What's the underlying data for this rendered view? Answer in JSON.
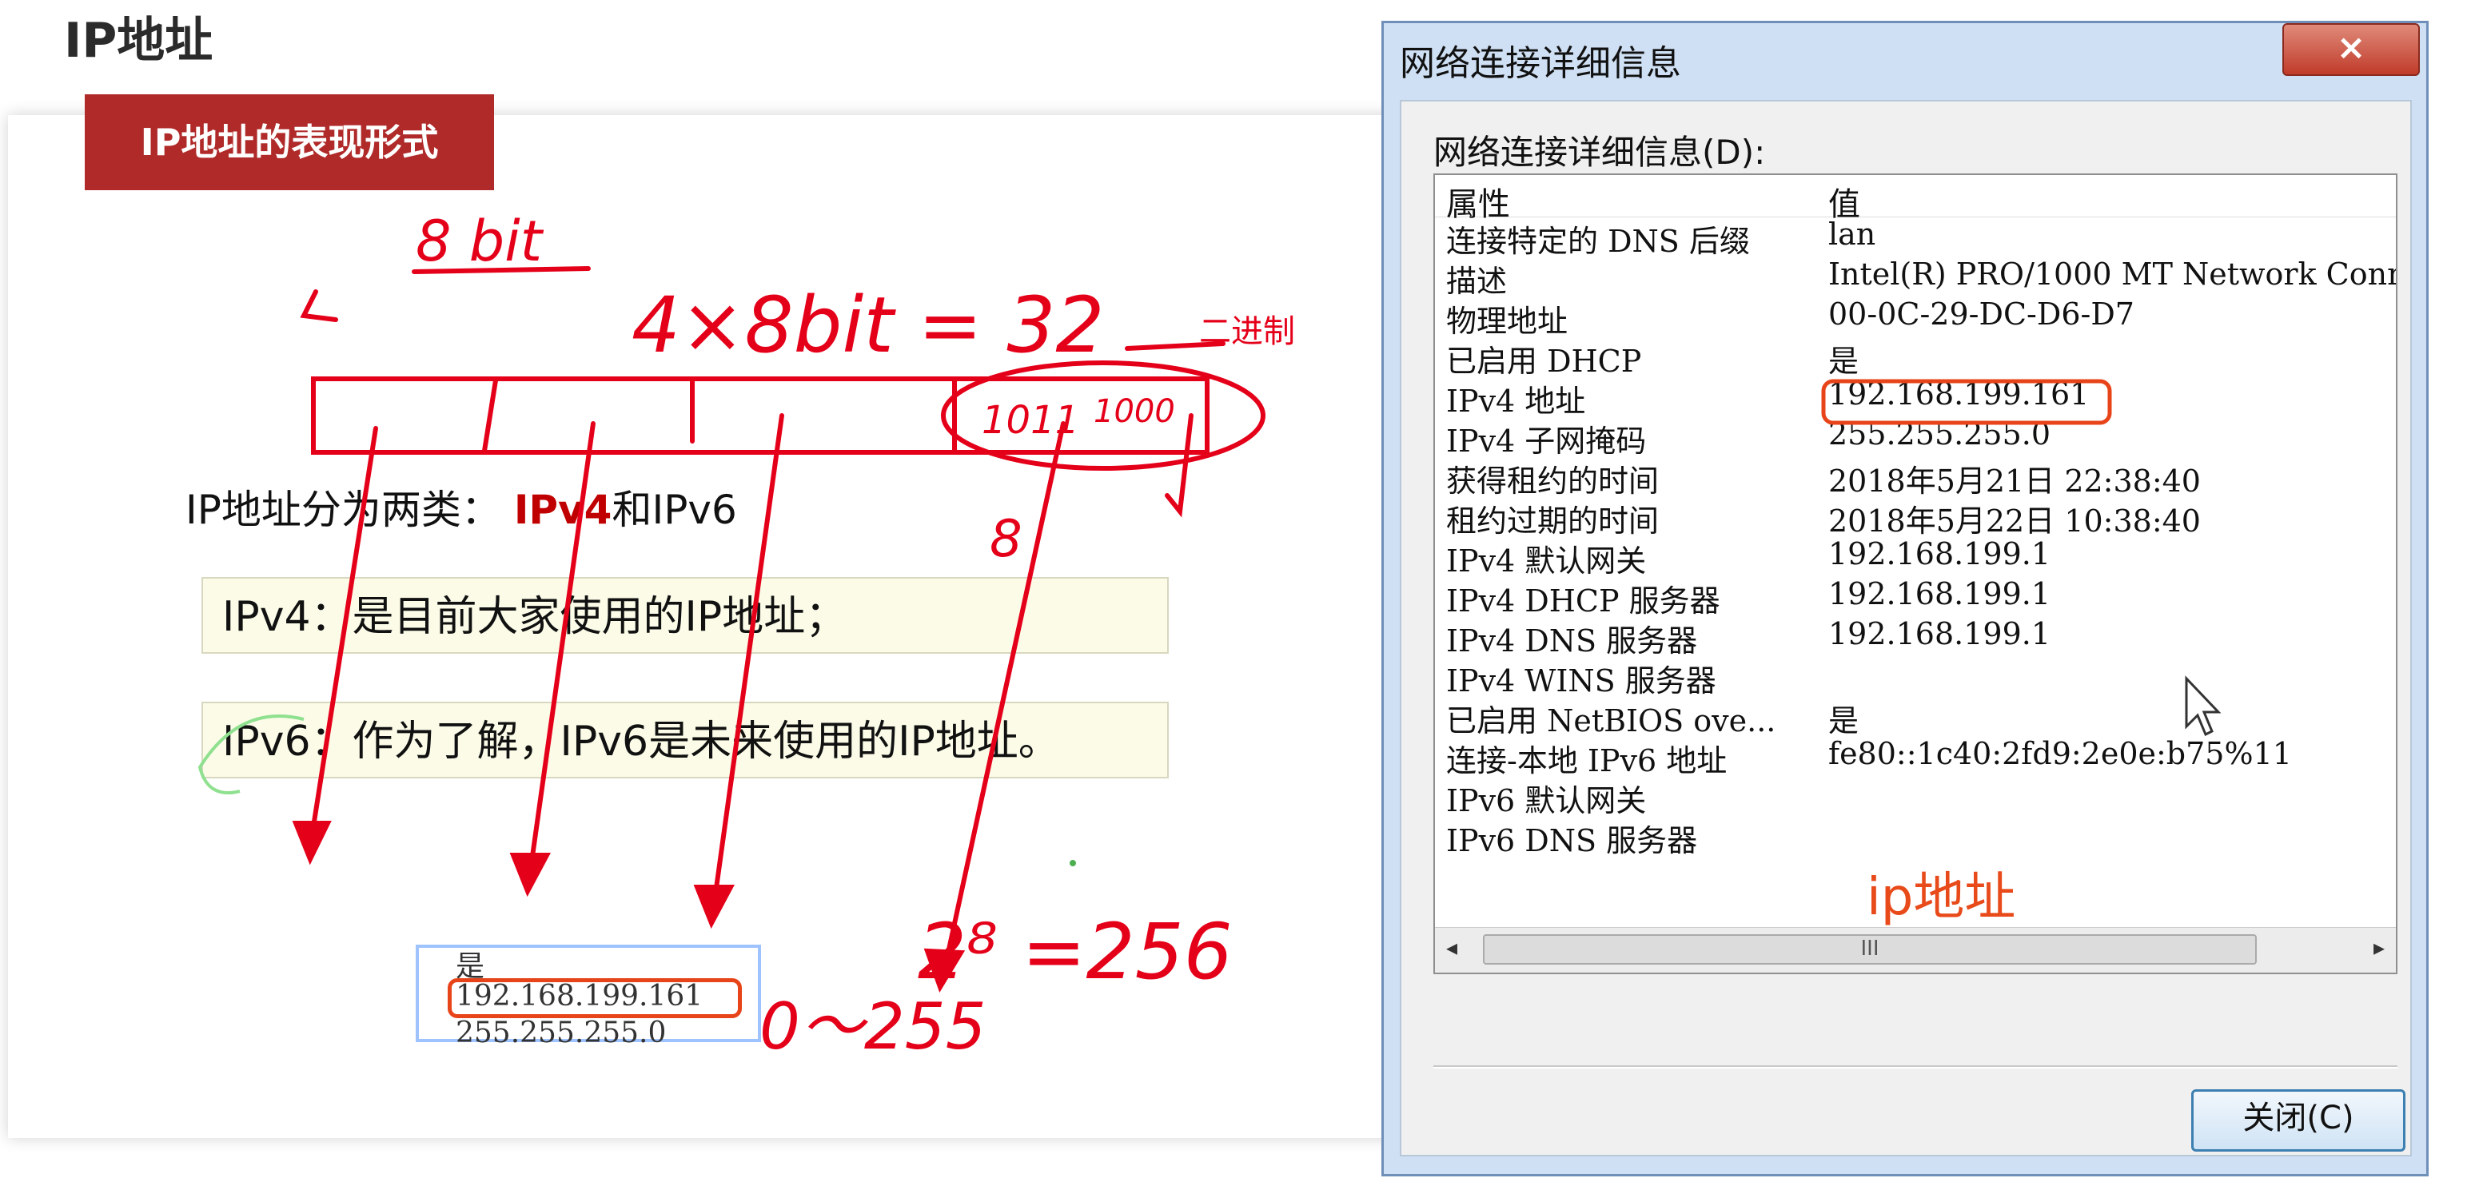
{
  "page_title": "IP地址",
  "section_tab": "IP地址的表现形式",
  "intro": {
    "prefix": "IP地址分为两类：",
    "ipv4": "IPv4",
    "middle": "和",
    "ipv6": "IPv6"
  },
  "boxes": {
    "ipv4_text": "IPv4：是目前大家使用的IP地址；",
    "ipv6_text": "IPv6：作为了解，IPv6是未来使用的IP地址。"
  },
  "snippet": {
    "row1": "是",
    "row2": "192.168.199.161",
    "row3": "255.255.255.0"
  },
  "annotations": {
    "8bit": "8 bit",
    "formula": "4×8bit = 32",
    "binary": "二进制",
    "bits_example_1": "1011",
    "bits_example_2": "1000",
    "range": "0～255",
    "pow": "2⁸ =256",
    "eight": "8"
  },
  "colors": {
    "accent_red": "#b02a2a",
    "annotation_red": "#e5001a",
    "highlight_orange": "#e8441a",
    "title_blue": "#cfe0f4"
  },
  "dialog": {
    "title": "网络连接详细信息",
    "close_icon": "×",
    "group_label": "网络连接详细信息(D):",
    "columns": {
      "property": "属性",
      "value": "值"
    },
    "rows": [
      {
        "p": "连接特定的 DNS 后缀",
        "v": "lan"
      },
      {
        "p": "描述",
        "v": "Intel(R) PRO/1000 MT Network Conne"
      },
      {
        "p": "物理地址",
        "v": "00-0C-29-DC-D6-D7"
      },
      {
        "p": "已启用 DHCP",
        "v": "是"
      },
      {
        "p": "IPv4 地址",
        "v": "192.168.199.161"
      },
      {
        "p": "IPv4 子网掩码",
        "v": "255.255.255.0"
      },
      {
        "p": "获得租约的时间",
        "v": "2018年5月21日 22:38:40"
      },
      {
        "p": "租约过期的时间",
        "v": "2018年5月22日 10:38:40"
      },
      {
        "p": "IPv4 默认网关",
        "v": "192.168.199.1"
      },
      {
        "p": "IPv4 DHCP 服务器",
        "v": "192.168.199.1"
      },
      {
        "p": "IPv4 DNS 服务器",
        "v": "192.168.199.1"
      },
      {
        "p": "IPv4 WINS 服务器",
        "v": ""
      },
      {
        "p": "已启用 NetBIOS ove...",
        "v": "是"
      },
      {
        "p": "连接-本地 IPv6 地址",
        "v": "fe80::1c40:2fd9:2e0e:b75%11"
      },
      {
        "p": "IPv6 默认网关",
        "v": ""
      },
      {
        "p": "IPv6 DNS 服务器",
        "v": ""
      }
    ],
    "ip_note": "ip地址",
    "scroll_grip": "III",
    "scroll_left": "◂",
    "scroll_right": "▸",
    "close_button": "关闭(C)"
  }
}
